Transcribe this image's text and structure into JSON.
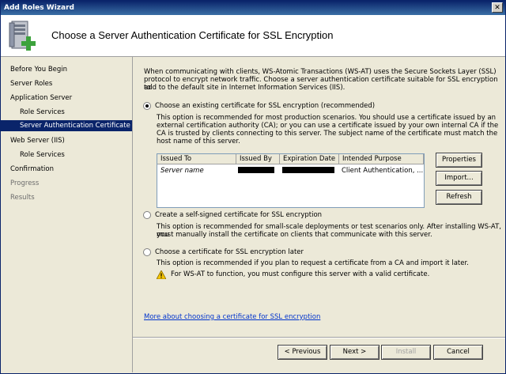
{
  "window": {
    "title": "Add Roles Wizard",
    "close_glyph": "✕"
  },
  "header": {
    "title": "Choose a Server Authentication Certificate for SSL Encryption",
    "icon": "server-add-icon"
  },
  "sidebar": {
    "items": [
      {
        "label": "Before You Begin"
      },
      {
        "label": "Server Roles"
      },
      {
        "label": "Application Server"
      },
      {
        "label": "Role Services"
      },
      {
        "label": "Server Authentication Certificate"
      },
      {
        "label": "Web Server (IIS)"
      },
      {
        "label": "Role Services"
      },
      {
        "label": "Confirmation"
      },
      {
        "label": "Progress"
      },
      {
        "label": "Results"
      }
    ]
  },
  "content": {
    "intro": [
      "When communicating with clients, WS-Atomic Transactions (WS-AT) uses the Secure Sockets Layer (SSL)",
      "protocol to encrypt network traffic. Choose a server authentication certificate suitable for SSL encryption to",
      "add to the default site in Internet Information Services (IIS)."
    ],
    "option1": {
      "label": "Choose an existing certificate for SSL encryption (recommended)",
      "desc": [
        "This option is recommended for most production scenarios. You should use a certificate issued by an",
        "external certification authority (CA); or you can use a certificate issued by your own internal CA if the",
        "CA is trusted by clients connecting to this server. The subject name of the certificate must match the",
        "host name of this server."
      ]
    },
    "table": {
      "headers": [
        "Issued To",
        "Issued By",
        "Expiration Date",
        "Intended Purpose"
      ],
      "row": {
        "issued_to": "Server name",
        "purpose": "Client Authentication, ..."
      }
    },
    "buttons": {
      "properties": "Properties",
      "import": "Import...",
      "refresh": "Refresh"
    },
    "option2": {
      "label": "Create a self-signed certificate for SSL encryption",
      "desc": [
        "This option is recommended for small-scale deployments or test scenarios only. After installing WS-AT, you",
        "must manually install the certificate on clients that communicate with this server."
      ]
    },
    "option3": {
      "label": "Choose a certificate for SSL encryption later",
      "desc": "This option is recommended if you plan to request a certificate from a CA and import it later.",
      "warning": "For WS-AT to function, you must configure this server with a valid certificate."
    },
    "more_link": "More about choosing a certificate for SSL encryption"
  },
  "footer": {
    "previous": "< Previous",
    "next": "Next >",
    "install": "Install",
    "cancel": "Cancel"
  }
}
